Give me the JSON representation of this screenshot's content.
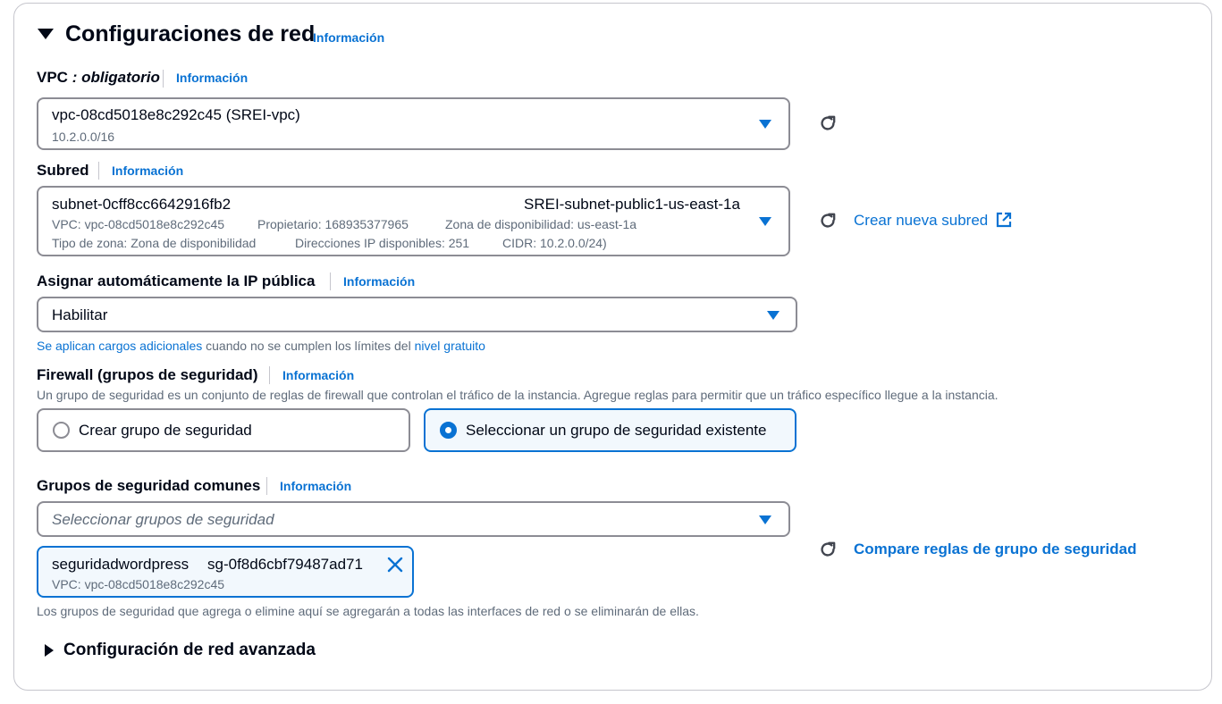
{
  "section": {
    "title": "Configuraciones de red",
    "info": "Información"
  },
  "vpc": {
    "label": "VPC",
    "required": " : obligatorio",
    "info": "Información",
    "value": "vpc-08cd5018e8c292c45 (SREI-vpc)",
    "cidr": "10.2.0.0/16"
  },
  "subnet": {
    "label": "Subred",
    "info": "Información",
    "id": "subnet-0cff8cc6642916fb2",
    "name": "SREI-subnet-public1-us-east-1a",
    "vpc": "VPC: vpc-08cd5018e8c292c45",
    "owner": "Propietario: 168935377965",
    "az": "Zona de disponibilidad: us-east-1a",
    "zone_type": "Tipo de zona: Zona de disponibilidad",
    "ips": "Direcciones IP disponibles: 251",
    "cidr": "CIDR: 10.2.0.0/24)",
    "create_link": "Crear nueva subred"
  },
  "public_ip": {
    "label": "Asignar automáticamente la IP pública",
    "info": "Información",
    "value": "Habilitar",
    "note_link1": "Se aplican cargos adicionales",
    "note_text": " cuando no se cumplen los límites del ",
    "note_link2": "nivel gratuito"
  },
  "firewall": {
    "label": "Firewall (grupos de seguridad)",
    "info": "Información",
    "description": "Un grupo de seguridad es un conjunto de reglas de firewall que controlan el tráfico de la instancia. Agregue reglas para permitir que un tráfico específico llegue a la instancia.",
    "option_create": "Crear grupo de seguridad",
    "option_existing": "Seleccionar un grupo de seguridad existente",
    "selected": "existing"
  },
  "common_groups": {
    "label": "Grupos de seguridad comunes",
    "info": "Información",
    "placeholder": "Seleccionar grupos de seguridad",
    "token_name": "seguridadwordpress",
    "token_id": "sg-0f8d6cbf79487ad71",
    "token_vpc": "VPC: vpc-08cd5018e8c292c45",
    "compare_link": "Compare reglas de grupo de seguridad",
    "note": "Los grupos de seguridad que agrega o elimine aquí se agregarán a todas las interfaces de red o se eliminarán de ellas."
  },
  "advanced": {
    "title": "Configuración de red avanzada"
  },
  "colors": {
    "link": "#0972d3",
    "text": "#000716",
    "muted": "#5f6b7a",
    "border": "#8c8c94",
    "selected_bg": "#f2f8fd"
  }
}
